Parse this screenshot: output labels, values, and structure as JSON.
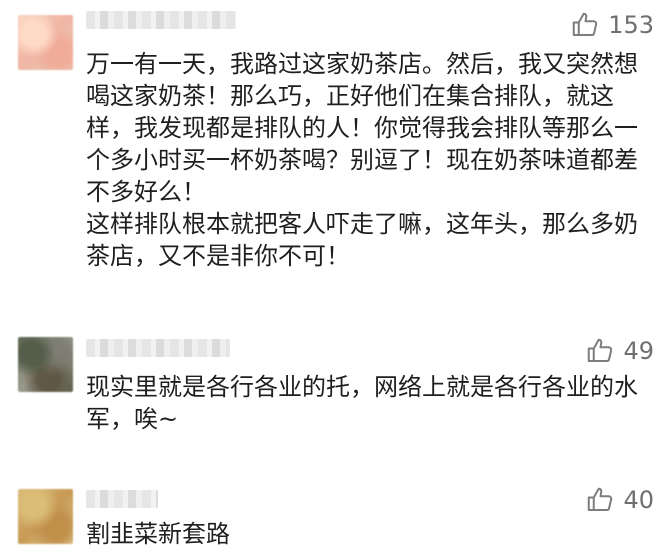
{
  "comments": [
    {
      "likes": "153",
      "text": "万一有一天，我路过这家奶茶店。然后，我又突然想喝这家奶茶！那么巧，正好他们在集合排队，就这样，我发现都是排队的人！你觉得我会排队等那么一个多小时买一杯奶茶喝？别逗了！现在奶茶味道都差不多好么！\n这样排队根本就把客人吓走了嘛，这年头，那么多奶茶店，又不是非你不可！"
    },
    {
      "likes": "49",
      "text": "现实里就是各行各业的托，网络上就是各行各业的水军，唉~"
    },
    {
      "likes": "40",
      "text": "割韭菜新套路"
    }
  ],
  "icons": {
    "like": "thumbs-up-icon"
  },
  "colors": {
    "text": "#1f1f1f",
    "meta": "#6f6f6f",
    "background": "#ffffff"
  }
}
